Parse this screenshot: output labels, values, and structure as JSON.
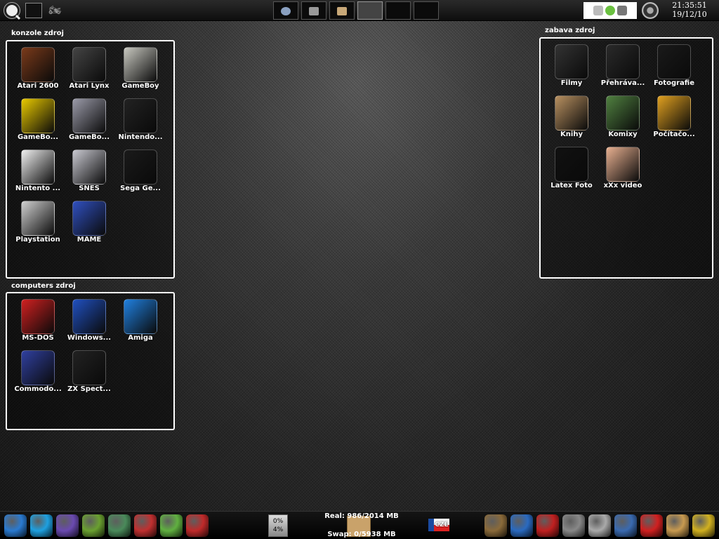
{
  "top_panel": {
    "clock": {
      "time": "21:35:51",
      "date": "19/12/10"
    },
    "pager": {
      "desktops": 6,
      "active_index": 3
    }
  },
  "widgets": {
    "konzole": {
      "title": "konzole zdroj",
      "items": [
        {
          "label": "Atari 2600",
          "icon": "atari-2600-icon",
          "color": "#7a3a1a"
        },
        {
          "label": "Atari Lynx",
          "icon": "atari-lynx-icon",
          "color": "#444444"
        },
        {
          "label": "GameBoy",
          "icon": "gameboy-icon",
          "color": "#c8c8c0"
        },
        {
          "label": "GameBo...",
          "icon": "gameboy-color-icon",
          "color": "#e8c800"
        },
        {
          "label": "GameBo...",
          "icon": "gameboy-advance-sp-icon",
          "color": "#9a9aa8"
        },
        {
          "label": "Nintendo...",
          "icon": "nintendo-64-icon",
          "color": "#222222"
        },
        {
          "label": "Nintento ...",
          "icon": "nintendo-ds-icon",
          "color": "#f0f0f0"
        },
        {
          "label": "SNES",
          "icon": "snes-icon",
          "color": "#c8c8d0"
        },
        {
          "label": "Sega Ge...",
          "icon": "sega-genesis-icon",
          "color": "#1a1a1a"
        },
        {
          "label": "Playstation",
          "icon": "playstation-icon",
          "color": "#d0d0d0"
        },
        {
          "label": "MAME",
          "icon": "mame-icon",
          "color": "#3050c0"
        }
      ]
    },
    "computers": {
      "title": "computers zdroj",
      "items": [
        {
          "label": "MS-DOS",
          "icon": "ms-dos-icon",
          "color": "#d02020"
        },
        {
          "label": "Windows...",
          "icon": "windows-icon",
          "color": "#2050c0"
        },
        {
          "label": "Amiga",
          "icon": "amiga-icon",
          "color": "#2080e0"
        },
        {
          "label": "Commodo...",
          "icon": "commodore-icon",
          "color": "#3040a0"
        },
        {
          "label": "ZX Spect...",
          "icon": "zx-spectrum-icon",
          "color": "#222222"
        }
      ]
    },
    "zabava": {
      "title": "zabava zdroj",
      "items": [
        {
          "label": "Filmy",
          "icon": "camcorder-icon",
          "color": "#333333"
        },
        {
          "label": "Přehráva...",
          "icon": "headphones-icon",
          "color": "#2a2a2a"
        },
        {
          "label": "Fotografie",
          "icon": "camera-icon",
          "color": "#1a1a1a"
        },
        {
          "label": "Knihy",
          "icon": "book-icon",
          "color": "#b89060"
        },
        {
          "label": "Komixy",
          "icon": "comics-icon",
          "color": "#508040"
        },
        {
          "label": "Počítačo...",
          "icon": "magazines-icon",
          "color": "#e0a020"
        },
        {
          "label": "Latex Foto",
          "icon": "latex-photo-icon",
          "color": "#111111"
        },
        {
          "label": "xXx video",
          "icon": "video-icon",
          "color": "#e8b090"
        }
      ]
    }
  },
  "bottom_panel": {
    "cpu": {
      "top": "0%",
      "bottom": "4%"
    },
    "memory": {
      "real": "Real: 986/2014 MB",
      "swap": "Swap: 0/5938 MB"
    },
    "keyboard_layout": "CZE",
    "left_launchers": [
      {
        "icon": "globe-icon",
        "color": "#2a7ad0"
      },
      {
        "icon": "skype-icon",
        "color": "#1ea0e0"
      },
      {
        "icon": "pidgin-icon",
        "color": "#6a4ab0"
      },
      {
        "icon": "phone-manager-icon",
        "color": "#6aa030"
      },
      {
        "icon": "network-monitor-icon",
        "color": "#4a8a5a"
      },
      {
        "icon": "joystick-icon",
        "color": "#c03030"
      },
      {
        "icon": "frog-messenger-icon",
        "color": "#60b040"
      },
      {
        "icon": "pcsx-icon",
        "color": "#c02a2a"
      }
    ],
    "right_launchers": [
      {
        "icon": "gimp-icon",
        "color": "#8a6a3a"
      },
      {
        "icon": "dropbox-icon",
        "color": "#2a6ac0"
      },
      {
        "icon": "dc-icon",
        "color": "#c02020"
      },
      {
        "icon": "monitor-icon",
        "color": "#888888"
      },
      {
        "icon": "calculator-icon",
        "color": "#aaaaaa"
      },
      {
        "icon": "system-monitor-icon",
        "color": "#3a6ab0"
      },
      {
        "icon": "home-icon",
        "color": "#d02020"
      },
      {
        "icon": "file-manager-icon",
        "color": "#c89a50"
      },
      {
        "icon": "world-clock-icon",
        "color": "#d0b020"
      }
    ]
  }
}
